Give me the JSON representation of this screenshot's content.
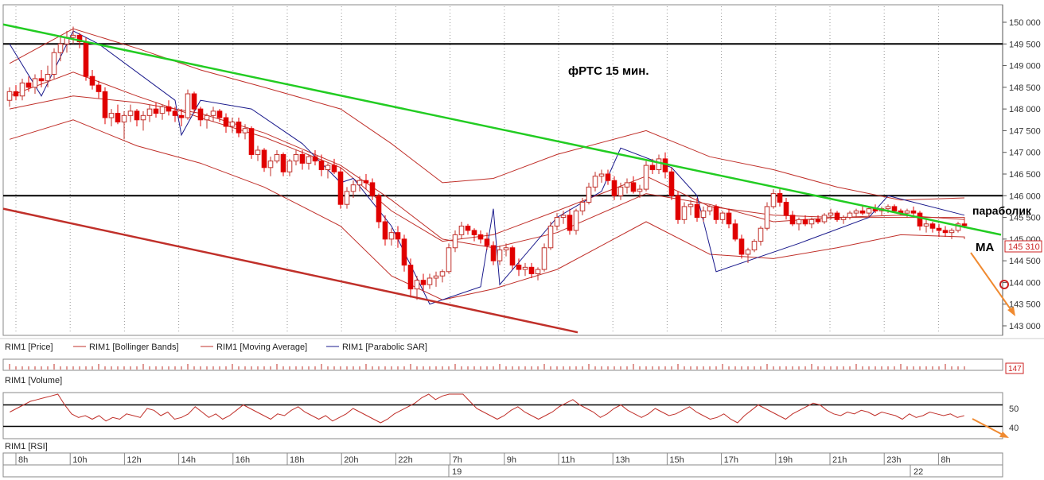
{
  "chart_data": {
    "type": "candlestick",
    "instrument": "RIM1",
    "title": "фРТС   15 мин.",
    "y_axis": {
      "min": 143000,
      "max": 150000,
      "ticks": [
        "150 000",
        "149 500",
        "149 000",
        "148 500",
        "148 000",
        "147 500",
        "147 000",
        "146 500",
        "146 000",
        "145 500",
        "145 000",
        "144 500",
        "144 000",
        "143 500",
        "143 000"
      ]
    },
    "last_price_label": "145 310",
    "last_price": 145310,
    "volume_last_label": "147",
    "rsi_ticks": [
      "50",
      "40"
    ],
    "rsi_levels": [
      52,
      40
    ],
    "x_axis": {
      "time_labels": [
        "8h",
        "10h",
        "12h",
        "14h",
        "16h",
        "18h",
        "20h",
        "22h",
        "7h",
        "9h",
        "11h",
        "13h",
        "15h",
        "17h",
        "19h",
        "21h",
        "23h",
        "8h"
      ],
      "date_labels": [
        "19",
        "22"
      ]
    },
    "legend": {
      "price": "RIM1 [Price]",
      "bollinger": "RIM1 [Bollinger Bands]",
      "moving_average": "RIM1 [Moving Average]",
      "parabolic_sar": "RIM1 [Parabolic SAR]",
      "volume": "RIM1 [Volume]",
      "rsi": "RIM1 [RSI]"
    },
    "annotations": {
      "parabolic_label": "параболик",
      "ma_label": "MA"
    },
    "horizontal_levels": [
      149500,
      146000
    ],
    "trendlines": [
      {
        "name": "resistance",
        "color": "#22cc22",
        "from_price": 149950,
        "to_price": 145100
      },
      {
        "name": "support",
        "color": "#c0302a",
        "from_price": 145700,
        "to_price": 142850
      }
    ],
    "candles": [
      [
        148200,
        148500,
        148050,
        148400
      ],
      [
        148400,
        148550,
        148200,
        148300
      ],
      [
        148300,
        148700,
        148200,
        148600
      ],
      [
        148600,
        148750,
        148400,
        148500
      ],
      [
        148500,
        148800,
        148350,
        148700
      ],
      [
        148700,
        148900,
        148500,
        148650
      ],
      [
        148650,
        149000,
        148500,
        148800
      ],
      [
        148800,
        149400,
        148700,
        149300
      ],
      [
        149300,
        149700,
        149100,
        149500
      ],
      [
        149500,
        149800,
        149300,
        149650
      ],
      [
        149650,
        149900,
        149500,
        149700
      ],
      [
        149700,
        149750,
        149400,
        149550
      ],
      [
        149550,
        149650,
        148650,
        148750
      ],
      [
        148750,
        148900,
        148450,
        148550
      ],
      [
        148550,
        148650,
        148250,
        148400
      ],
      [
        148400,
        148500,
        147650,
        147800
      ],
      [
        147800,
        148000,
        147600,
        147900
      ],
      [
        147900,
        148100,
        147650,
        147700
      ],
      [
        147700,
        147950,
        147300,
        147850
      ],
      [
        147850,
        148100,
        147700,
        147950
      ],
      [
        147950,
        148000,
        147600,
        147750
      ],
      [
        147750,
        147950,
        147500,
        147850
      ],
      [
        147850,
        148100,
        147700,
        148000
      ],
      [
        148000,
        148150,
        147800,
        147900
      ],
      [
        147900,
        148100,
        147750,
        148050
      ],
      [
        148050,
        148200,
        147850,
        147950
      ],
      [
        147950,
        148050,
        147700,
        147850
      ],
      [
        147850,
        148000,
        147600,
        147800
      ],
      [
        147800,
        148450,
        147750,
        148350
      ],
      [
        148350,
        148400,
        147900,
        148000
      ],
      [
        148000,
        148050,
        147600,
        147750
      ],
      [
        147750,
        147900,
        147550,
        147850
      ],
      [
        147850,
        148050,
        147700,
        147950
      ],
      [
        147950,
        148000,
        147700,
        147800
      ],
      [
        147800,
        147900,
        147450,
        147600
      ],
      [
        147600,
        147800,
        147450,
        147700
      ],
      [
        147700,
        147800,
        147350,
        147450
      ],
      [
        147450,
        147650,
        147300,
        147550
      ],
      [
        147550,
        147600,
        146850,
        146950
      ],
      [
        146950,
        147150,
        146800,
        147050
      ],
      [
        147050,
        147100,
        146550,
        146650
      ],
      [
        146650,
        146900,
        146450,
        146800
      ],
      [
        146800,
        147050,
        146750,
        146950
      ],
      [
        146950,
        147000,
        146450,
        146550
      ],
      [
        146550,
        146850,
        146450,
        146800
      ],
      [
        146800,
        147050,
        146700,
        146950
      ],
      [
        146950,
        147050,
        146600,
        146750
      ],
      [
        146750,
        146950,
        146600,
        146900
      ],
      [
        146900,
        147050,
        146700,
        146800
      ],
      [
        146800,
        146950,
        146450,
        146600
      ],
      [
        146600,
        146750,
        146400,
        146700
      ],
      [
        146700,
        146850,
        146500,
        146550
      ],
      [
        146550,
        146650,
        145700,
        145800
      ],
      [
        145800,
        146200,
        145700,
        146100
      ],
      [
        146100,
        146350,
        145950,
        146250
      ],
      [
        146250,
        146450,
        146100,
        146350
      ],
      [
        146350,
        146500,
        146150,
        146300
      ],
      [
        146300,
        146400,
        145900,
        146000
      ],
      [
        146000,
        146050,
        145250,
        145400
      ],
      [
        145400,
        145550,
        144850,
        145000
      ],
      [
        145000,
        145250,
        144850,
        145150
      ],
      [
        145150,
        145300,
        144800,
        145000
      ],
      [
        145000,
        145100,
        144250,
        144400
      ],
      [
        144400,
        144550,
        143650,
        143850
      ],
      [
        143850,
        144150,
        143600,
        144050
      ],
      [
        144050,
        144200,
        143800,
        143950
      ],
      [
        143950,
        144200,
        143850,
        144100
      ],
      [
        144100,
        144250,
        143900,
        144150
      ],
      [
        144150,
        144300,
        144000,
        144250
      ],
      [
        144250,
        144900,
        144200,
        144800
      ],
      [
        144800,
        145200,
        144700,
        145100
      ],
      [
        145100,
        145400,
        145000,
        145300
      ],
      [
        145300,
        145350,
        145100,
        145200
      ],
      [
        145200,
        145250,
        144950,
        145100
      ],
      [
        145100,
        145200,
        144900,
        145000
      ],
      [
        145000,
        145150,
        144750,
        144850
      ],
      [
        144850,
        144950,
        144400,
        144500
      ],
      [
        144500,
        144850,
        144400,
        144750
      ],
      [
        144750,
        144900,
        144600,
        144800
      ],
      [
        144800,
        144850,
        144300,
        144400
      ],
      [
        144400,
        144550,
        144150,
        144300
      ],
      [
        144300,
        144450,
        144150,
        144350
      ],
      [
        144350,
        144450,
        144100,
        144200
      ],
      [
        144200,
        144350,
        144050,
        144300
      ],
      [
        144300,
        144900,
        144250,
        144800
      ],
      [
        144800,
        145400,
        144750,
        145300
      ],
      [
        145300,
        145600,
        145200,
        145500
      ],
      [
        145500,
        145650,
        145350,
        145550
      ],
      [
        145550,
        145700,
        145100,
        145200
      ],
      [
        145200,
        145700,
        145100,
        145650
      ],
      [
        145650,
        145950,
        145550,
        145850
      ],
      [
        145850,
        146300,
        145800,
        146200
      ],
      [
        146200,
        146550,
        146100,
        146450
      ],
      [
        146450,
        146600,
        146300,
        146500
      ],
      [
        146500,
        146600,
        146250,
        146350
      ],
      [
        146350,
        146450,
        145900,
        146000
      ],
      [
        146000,
        146300,
        145900,
        146200
      ],
      [
        146200,
        146400,
        146050,
        146300
      ],
      [
        146300,
        146450,
        146050,
        146100
      ],
      [
        146100,
        146250,
        145950,
        146150
      ],
      [
        146150,
        146800,
        146100,
        146700
      ],
      [
        146700,
        146850,
        146500,
        146600
      ],
      [
        146600,
        146950,
        146500,
        146850
      ],
      [
        146850,
        147000,
        146400,
        146550
      ],
      [
        146550,
        146650,
        145900,
        146000
      ],
      [
        146000,
        146100,
        145350,
        145450
      ],
      [
        145450,
        145850,
        145350,
        145750
      ],
      [
        145750,
        145900,
        145550,
        145800
      ],
      [
        145800,
        145950,
        145400,
        145500
      ],
      [
        145500,
        145750,
        145400,
        145650
      ],
      [
        145650,
        145800,
        145550,
        145750
      ],
      [
        145750,
        145800,
        145350,
        145450
      ],
      [
        145450,
        145650,
        145350,
        145600
      ],
      [
        145600,
        145700,
        145250,
        145350
      ],
      [
        145350,
        145450,
        144950,
        145000
      ],
      [
        145000,
        145100,
        144550,
        144650
      ],
      [
        144650,
        144800,
        144450,
        144750
      ],
      [
        144750,
        145000,
        144700,
        144950
      ],
      [
        144950,
        145300,
        144850,
        145250
      ],
      [
        145250,
        145850,
        145200,
        145750
      ],
      [
        145750,
        146150,
        145700,
        146050
      ],
      [
        146050,
        146150,
        145750,
        145850
      ],
      [
        145850,
        145950,
        145450,
        145550
      ],
      [
        145550,
        145650,
        145300,
        145350
      ],
      [
        145350,
        145500,
        145200,
        145450
      ],
      [
        145450,
        145550,
        145300,
        145350
      ],
      [
        145350,
        145500,
        145250,
        145450
      ],
      [
        145450,
        145550,
        145350,
        145400
      ],
      [
        145400,
        145600,
        145350,
        145550
      ],
      [
        145550,
        145700,
        145450,
        145600
      ],
      [
        145600,
        145650,
        145400,
        145450
      ],
      [
        145450,
        145550,
        145350,
        145500
      ],
      [
        145500,
        145650,
        145450,
        145600
      ],
      [
        145600,
        145700,
        145500,
        145650
      ],
      [
        145650,
        145750,
        145550,
        145600
      ],
      [
        145600,
        145750,
        145500,
        145700
      ],
      [
        145700,
        145800,
        145600,
        145650
      ],
      [
        145650,
        145750,
        145550,
        145700
      ],
      [
        145700,
        145800,
        145600,
        145750
      ],
      [
        145750,
        145800,
        145600,
        145650
      ],
      [
        145650,
        145700,
        145550,
        145600
      ],
      [
        145600,
        145700,
        145500,
        145650
      ],
      [
        145650,
        145750,
        145550,
        145600
      ],
      [
        145600,
        145650,
        145200,
        145300
      ],
      [
        145300,
        145450,
        145150,
        145350
      ],
      [
        145350,
        145400,
        145150,
        145250
      ],
      [
        145250,
        145350,
        145050,
        145200
      ],
      [
        145200,
        145300,
        145050,
        145150
      ],
      [
        145150,
        145250,
        145000,
        145200
      ],
      [
        145200,
        145400,
        145150,
        145350
      ],
      [
        145350,
        145400,
        145250,
        145310
      ]
    ],
    "bollinger": {
      "upper": [
        [
          0,
          149050
        ],
        [
          10,
          149850
        ],
        [
          20,
          149400
        ],
        [
          30,
          148900
        ],
        [
          40,
          148500
        ],
        [
          52,
          148000
        ],
        [
          60,
          147200
        ],
        [
          68,
          146300
        ],
        [
          76,
          146400
        ],
        [
          86,
          146950
        ],
        [
          100,
          147500
        ],
        [
          110,
          146900
        ],
        [
          120,
          146600
        ],
        [
          130,
          146200
        ],
        [
          140,
          145900
        ],
        [
          150,
          145950
        ],
        [
          154,
          145950
        ]
      ],
      "lower": [
        [
          0,
          147300
        ],
        [
          10,
          147750
        ],
        [
          20,
          147150
        ],
        [
          30,
          146750
        ],
        [
          40,
          146200
        ],
        [
          52,
          145300
        ],
        [
          60,
          144150
        ],
        [
          68,
          143600
        ],
        [
          76,
          143850
        ],
        [
          86,
          144300
        ],
        [
          100,
          145400
        ],
        [
          110,
          144650
        ],
        [
          120,
          144550
        ],
        [
          130,
          144800
        ],
        [
          140,
          145100
        ],
        [
          150,
          145050
        ],
        [
          154,
          145000
        ]
      ],
      "middle": [
        [
          0,
          148300
        ],
        [
          10,
          148850
        ],
        [
          20,
          148300
        ],
        [
          30,
          147800
        ],
        [
          40,
          147350
        ],
        [
          52,
          146650
        ],
        [
          60,
          145650
        ],
        [
          68,
          144950
        ],
        [
          76,
          145100
        ],
        [
          86,
          145650
        ],
        [
          100,
          146450
        ],
        [
          110,
          145750
        ],
        [
          120,
          145550
        ],
        [
          130,
          145500
        ],
        [
          140,
          145500
        ],
        [
          150,
          145500
        ],
        [
          154,
          145450
        ]
      ]
    },
    "moving_average": [
      [
        0,
        148000
      ],
      [
        10,
        148300
      ],
      [
        20,
        148150
      ],
      [
        30,
        147900
      ],
      [
        40,
        147450
      ],
      [
        52,
        146700
      ],
      [
        60,
        145900
      ],
      [
        68,
        145000
      ],
      [
        76,
        144800
      ],
      [
        86,
        145150
      ],
      [
        100,
        146050
      ],
      [
        110,
        145800
      ],
      [
        120,
        145400
      ],
      [
        130,
        145500
      ],
      [
        140,
        145550
      ],
      [
        150,
        145450
      ],
      [
        154,
        145400
      ]
    ],
    "parabolic_sar": [
      [
        0,
        149500
      ],
      [
        5,
        148300
      ],
      [
        10,
        149800
      ],
      [
        14,
        149500
      ],
      [
        26,
        148200
      ],
      [
        27,
        147400
      ],
      [
        30,
        148200
      ],
      [
        38,
        148000
      ],
      [
        46,
        147200
      ],
      [
        52,
        146300
      ],
      [
        54,
        146400
      ],
      [
        60,
        145300
      ],
      [
        66,
        143500
      ],
      [
        74,
        143900
      ],
      [
        76,
        145700
      ],
      [
        77,
        143950
      ],
      [
        86,
        145500
      ],
      [
        93,
        146100
      ],
      [
        96,
        147100
      ],
      [
        104,
        146650
      ],
      [
        108,
        146000
      ],
      [
        111,
        144250
      ],
      [
        124,
        144900
      ],
      [
        135,
        145500
      ],
      [
        138,
        146000
      ],
      [
        150,
        145550
      ]
    ],
    "rsi": [
      48,
      50,
      52,
      54,
      55,
      56,
      57,
      58,
      52,
      47,
      45,
      46,
      44,
      46,
      43,
      45,
      44,
      47,
      46,
      45,
      50,
      49,
      46,
      48,
      44,
      45,
      47,
      51,
      48,
      45,
      47,
      44,
      46,
      49,
      52,
      50,
      48,
      46,
      44,
      47,
      46,
      49,
      51,
      48,
      46,
      44,
      46,
      43,
      45,
      47,
      50,
      48,
      46,
      44,
      42,
      44,
      47,
      49,
      51,
      53,
      56,
      58,
      55,
      57,
      59,
      60,
      58,
      54,
      50,
      48,
      46,
      44,
      46,
      49,
      51,
      48,
      46,
      44,
      46,
      48,
      51,
      53,
      55,
      52,
      50,
      48,
      45,
      47,
      50,
      52,
      49,
      47,
      45,
      47,
      50,
      48,
      46,
      47,
      49,
      51,
      48,
      46,
      44,
      45,
      47,
      44,
      42,
      46,
      49,
      52,
      50,
      48,
      46,
      44,
      47,
      49,
      51,
      53,
      52,
      49,
      47,
      46,
      48,
      47,
      49,
      48,
      46,
      48,
      47,
      46,
      44,
      47,
      45,
      46,
      48,
      47,
      46,
      47,
      45,
      46
    ]
  }
}
